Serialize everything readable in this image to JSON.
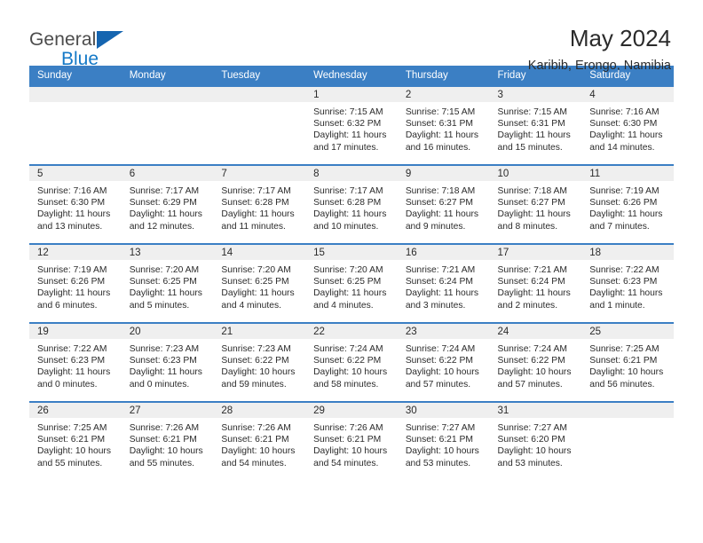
{
  "brand": {
    "name_part1": "General",
    "name_part2": "Blue",
    "triangle_color": "#1565b0",
    "blue_color": "#1479c7"
  },
  "header": {
    "title": "May 2024",
    "location": "Karibib, Erongo, Namibia"
  },
  "theme": {
    "header_blue": "#3b7fc4",
    "daynum_band": "#efefef",
    "text": "#2b2b2b"
  },
  "weekdays": [
    "Sunday",
    "Monday",
    "Tuesday",
    "Wednesday",
    "Thursday",
    "Friday",
    "Saturday"
  ],
  "weeks": [
    [
      {
        "day": "",
        "sunrise": "",
        "sunset": "",
        "daylight1": "",
        "daylight2": "",
        "empty": true
      },
      {
        "day": "",
        "sunrise": "",
        "sunset": "",
        "daylight1": "",
        "daylight2": "",
        "empty": true
      },
      {
        "day": "",
        "sunrise": "",
        "sunset": "",
        "daylight1": "",
        "daylight2": "",
        "empty": true
      },
      {
        "day": "1",
        "sunrise": "Sunrise: 7:15 AM",
        "sunset": "Sunset: 6:32 PM",
        "daylight1": "Daylight: 11 hours",
        "daylight2": "and 17 minutes."
      },
      {
        "day": "2",
        "sunrise": "Sunrise: 7:15 AM",
        "sunset": "Sunset: 6:31 PM",
        "daylight1": "Daylight: 11 hours",
        "daylight2": "and 16 minutes."
      },
      {
        "day": "3",
        "sunrise": "Sunrise: 7:15 AM",
        "sunset": "Sunset: 6:31 PM",
        "daylight1": "Daylight: 11 hours",
        "daylight2": "and 15 minutes."
      },
      {
        "day": "4",
        "sunrise": "Sunrise: 7:16 AM",
        "sunset": "Sunset: 6:30 PM",
        "daylight1": "Daylight: 11 hours",
        "daylight2": "and 14 minutes."
      }
    ],
    [
      {
        "day": "5",
        "sunrise": "Sunrise: 7:16 AM",
        "sunset": "Sunset: 6:30 PM",
        "daylight1": "Daylight: 11 hours",
        "daylight2": "and 13 minutes."
      },
      {
        "day": "6",
        "sunrise": "Sunrise: 7:17 AM",
        "sunset": "Sunset: 6:29 PM",
        "daylight1": "Daylight: 11 hours",
        "daylight2": "and 12 minutes."
      },
      {
        "day": "7",
        "sunrise": "Sunrise: 7:17 AM",
        "sunset": "Sunset: 6:28 PM",
        "daylight1": "Daylight: 11 hours",
        "daylight2": "and 11 minutes."
      },
      {
        "day": "8",
        "sunrise": "Sunrise: 7:17 AM",
        "sunset": "Sunset: 6:28 PM",
        "daylight1": "Daylight: 11 hours",
        "daylight2": "and 10 minutes."
      },
      {
        "day": "9",
        "sunrise": "Sunrise: 7:18 AM",
        "sunset": "Sunset: 6:27 PM",
        "daylight1": "Daylight: 11 hours",
        "daylight2": "and 9 minutes."
      },
      {
        "day": "10",
        "sunrise": "Sunrise: 7:18 AM",
        "sunset": "Sunset: 6:27 PM",
        "daylight1": "Daylight: 11 hours",
        "daylight2": "and 8 minutes."
      },
      {
        "day": "11",
        "sunrise": "Sunrise: 7:19 AM",
        "sunset": "Sunset: 6:26 PM",
        "daylight1": "Daylight: 11 hours",
        "daylight2": "and 7 minutes."
      }
    ],
    [
      {
        "day": "12",
        "sunrise": "Sunrise: 7:19 AM",
        "sunset": "Sunset: 6:26 PM",
        "daylight1": "Daylight: 11 hours",
        "daylight2": "and 6 minutes."
      },
      {
        "day": "13",
        "sunrise": "Sunrise: 7:20 AM",
        "sunset": "Sunset: 6:25 PM",
        "daylight1": "Daylight: 11 hours",
        "daylight2": "and 5 minutes."
      },
      {
        "day": "14",
        "sunrise": "Sunrise: 7:20 AM",
        "sunset": "Sunset: 6:25 PM",
        "daylight1": "Daylight: 11 hours",
        "daylight2": "and 4 minutes."
      },
      {
        "day": "15",
        "sunrise": "Sunrise: 7:20 AM",
        "sunset": "Sunset: 6:25 PM",
        "daylight1": "Daylight: 11 hours",
        "daylight2": "and 4 minutes."
      },
      {
        "day": "16",
        "sunrise": "Sunrise: 7:21 AM",
        "sunset": "Sunset: 6:24 PM",
        "daylight1": "Daylight: 11 hours",
        "daylight2": "and 3 minutes."
      },
      {
        "day": "17",
        "sunrise": "Sunrise: 7:21 AM",
        "sunset": "Sunset: 6:24 PM",
        "daylight1": "Daylight: 11 hours",
        "daylight2": "and 2 minutes."
      },
      {
        "day": "18",
        "sunrise": "Sunrise: 7:22 AM",
        "sunset": "Sunset: 6:23 PM",
        "daylight1": "Daylight: 11 hours",
        "daylight2": "and 1 minute."
      }
    ],
    [
      {
        "day": "19",
        "sunrise": "Sunrise: 7:22 AM",
        "sunset": "Sunset: 6:23 PM",
        "daylight1": "Daylight: 11 hours",
        "daylight2": "and 0 minutes."
      },
      {
        "day": "20",
        "sunrise": "Sunrise: 7:23 AM",
        "sunset": "Sunset: 6:23 PM",
        "daylight1": "Daylight: 11 hours",
        "daylight2": "and 0 minutes."
      },
      {
        "day": "21",
        "sunrise": "Sunrise: 7:23 AM",
        "sunset": "Sunset: 6:22 PM",
        "daylight1": "Daylight: 10 hours",
        "daylight2": "and 59 minutes."
      },
      {
        "day": "22",
        "sunrise": "Sunrise: 7:24 AM",
        "sunset": "Sunset: 6:22 PM",
        "daylight1": "Daylight: 10 hours",
        "daylight2": "and 58 minutes."
      },
      {
        "day": "23",
        "sunrise": "Sunrise: 7:24 AM",
        "sunset": "Sunset: 6:22 PM",
        "daylight1": "Daylight: 10 hours",
        "daylight2": "and 57 minutes."
      },
      {
        "day": "24",
        "sunrise": "Sunrise: 7:24 AM",
        "sunset": "Sunset: 6:22 PM",
        "daylight1": "Daylight: 10 hours",
        "daylight2": "and 57 minutes."
      },
      {
        "day": "25",
        "sunrise": "Sunrise: 7:25 AM",
        "sunset": "Sunset: 6:21 PM",
        "daylight1": "Daylight: 10 hours",
        "daylight2": "and 56 minutes."
      }
    ],
    [
      {
        "day": "26",
        "sunrise": "Sunrise: 7:25 AM",
        "sunset": "Sunset: 6:21 PM",
        "daylight1": "Daylight: 10 hours",
        "daylight2": "and 55 minutes."
      },
      {
        "day": "27",
        "sunrise": "Sunrise: 7:26 AM",
        "sunset": "Sunset: 6:21 PM",
        "daylight1": "Daylight: 10 hours",
        "daylight2": "and 55 minutes."
      },
      {
        "day": "28",
        "sunrise": "Sunrise: 7:26 AM",
        "sunset": "Sunset: 6:21 PM",
        "daylight1": "Daylight: 10 hours",
        "daylight2": "and 54 minutes."
      },
      {
        "day": "29",
        "sunrise": "Sunrise: 7:26 AM",
        "sunset": "Sunset: 6:21 PM",
        "daylight1": "Daylight: 10 hours",
        "daylight2": "and 54 minutes."
      },
      {
        "day": "30",
        "sunrise": "Sunrise: 7:27 AM",
        "sunset": "Sunset: 6:21 PM",
        "daylight1": "Daylight: 10 hours",
        "daylight2": "and 53 minutes."
      },
      {
        "day": "31",
        "sunrise": "Sunrise: 7:27 AM",
        "sunset": "Sunset: 6:20 PM",
        "daylight1": "Daylight: 10 hours",
        "daylight2": "and 53 minutes."
      },
      {
        "day": "",
        "sunrise": "",
        "sunset": "",
        "daylight1": "",
        "daylight2": "",
        "empty": true
      }
    ]
  ]
}
